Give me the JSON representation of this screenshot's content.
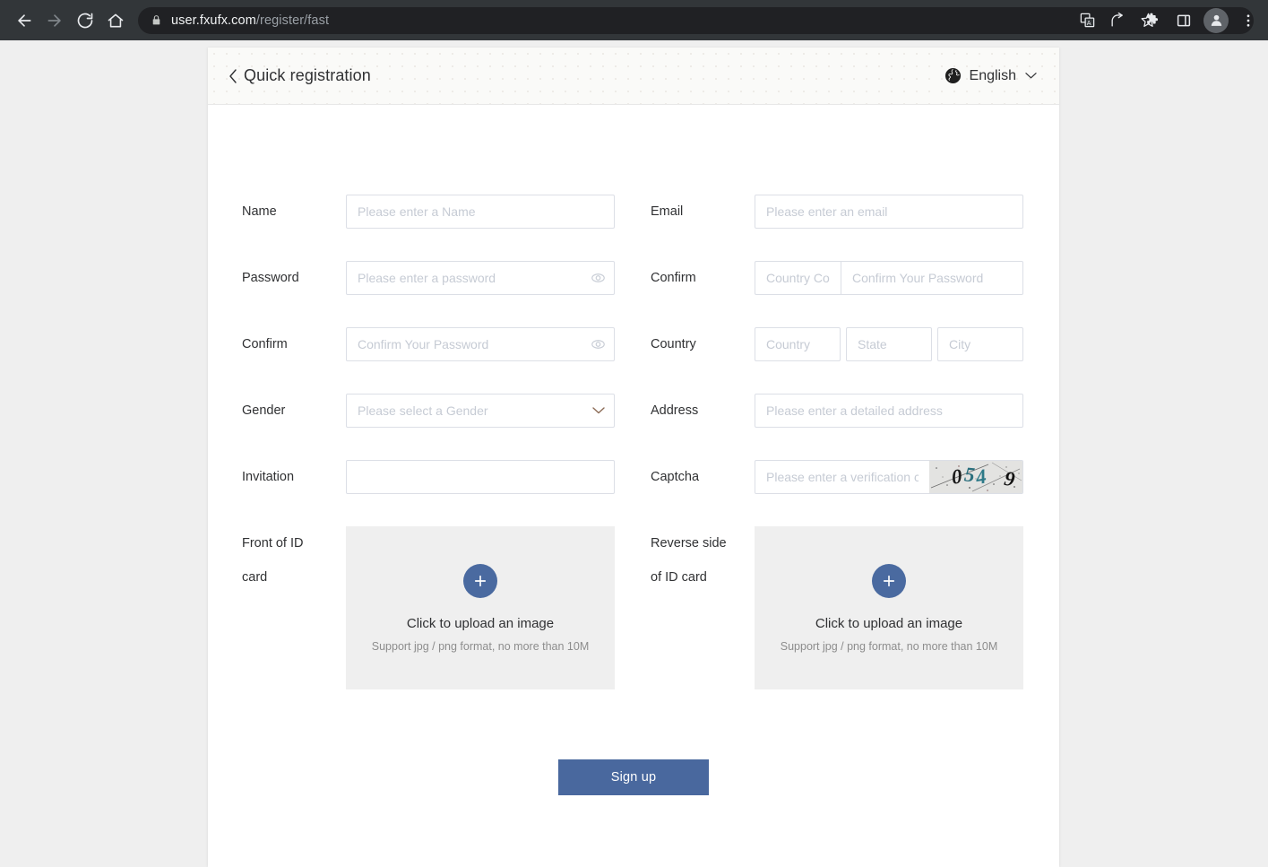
{
  "browser": {
    "url_host": "user.fxufx.com",
    "url_path": "/register/fast",
    "icons": {
      "back": "back-arrow-icon",
      "forward": "forward-arrow-icon",
      "reload": "reload-icon",
      "home": "home-icon",
      "lock": "lock-icon",
      "translate": "translate-icon",
      "share": "share-icon",
      "bookmark": "star-icon",
      "extensions": "puzzle-icon",
      "side_panel": "side-panel-icon",
      "profile": "profile-avatar-icon",
      "menu": "three-dot-menu-icon"
    }
  },
  "header": {
    "title": "Quick registration",
    "back_label": "‹",
    "language": "English"
  },
  "form": {
    "rows": [
      {
        "left": {
          "label": "Name",
          "placeholder": "Please enter a Name"
        },
        "right": {
          "label": "Email",
          "placeholder": "Please enter an email"
        }
      },
      {
        "left": {
          "label": "Password",
          "placeholder": "Please enter a password"
        },
        "right": {
          "label": "Confirm",
          "placeholder_code": "Country Code",
          "placeholder": "Confirm Your Password"
        }
      },
      {
        "left": {
          "label": "Confirm",
          "placeholder": "Confirm Your Password"
        },
        "right": {
          "label": "Country",
          "placeholder_country": "Country",
          "placeholder_state": "State",
          "placeholder_city": "City"
        }
      },
      {
        "left": {
          "label": "Gender",
          "placeholder": "Please select a Gender"
        },
        "right": {
          "label": "Address",
          "placeholder": "Please enter a detailed address"
        }
      },
      {
        "left": {
          "label": "Invitation",
          "value": "",
          "placeholder": ""
        },
        "right": {
          "label": "Captcha",
          "placeholder": "Please enter a verification code",
          "captcha_code": "0549"
        }
      }
    ],
    "uploads": {
      "front": {
        "label_line1": "Front of ID",
        "label_line2": "card",
        "title": "Click to upload an image",
        "hint": "Support jpg / png format, no more than 10M"
      },
      "reverse": {
        "label_line1": "Reverse side",
        "label_line2": "of ID card",
        "title": "Click to upload an image",
        "hint": "Support jpg / png format, no more than 10M"
      }
    },
    "submit_label": "Sign up"
  },
  "colors": {
    "accent": "#49689e",
    "page_bg": "#efefef",
    "card_bg": "#ffffff",
    "border": "#dcdfe6",
    "text": "#303133",
    "placeholder": "#c6cbd4"
  }
}
